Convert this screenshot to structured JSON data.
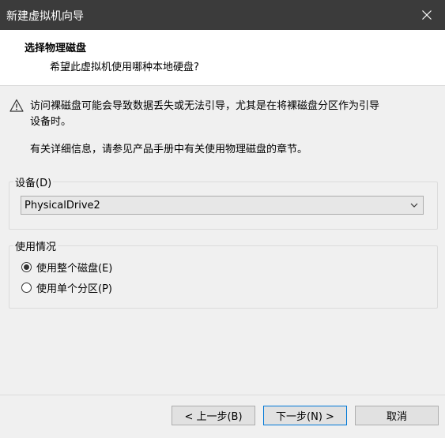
{
  "window": {
    "title": "新建虚拟机向导"
  },
  "header": {
    "heading": "选择物理磁盘",
    "subheading": "希望此虚拟机使用哪种本地硬盘?"
  },
  "warning": {
    "line1": "访问裸磁盘可能会导致数据丢失或无法引导，尤其是在将裸磁盘分区作为引导",
    "line2": "设备时。"
  },
  "info": {
    "text": "有关详细信息，请参见产品手册中有关使用物理磁盘的章节。"
  },
  "device": {
    "label": "设备(D)",
    "selected": "PhysicalDrive2"
  },
  "usage": {
    "label": "使用情况",
    "options": [
      {
        "label": "使用整个磁盘(E)",
        "checked": true
      },
      {
        "label": "使用单个分区(P)",
        "checked": false
      }
    ]
  },
  "buttons": {
    "back": "< 上一步(B)",
    "next": "下一步(N) >",
    "cancel": "取消"
  },
  "colors": {
    "titlebar": "#3b3b3b",
    "dialog_bg": "#f0f0f0",
    "header_bg": "#ffffff",
    "default_button_border": "#0078d7"
  }
}
